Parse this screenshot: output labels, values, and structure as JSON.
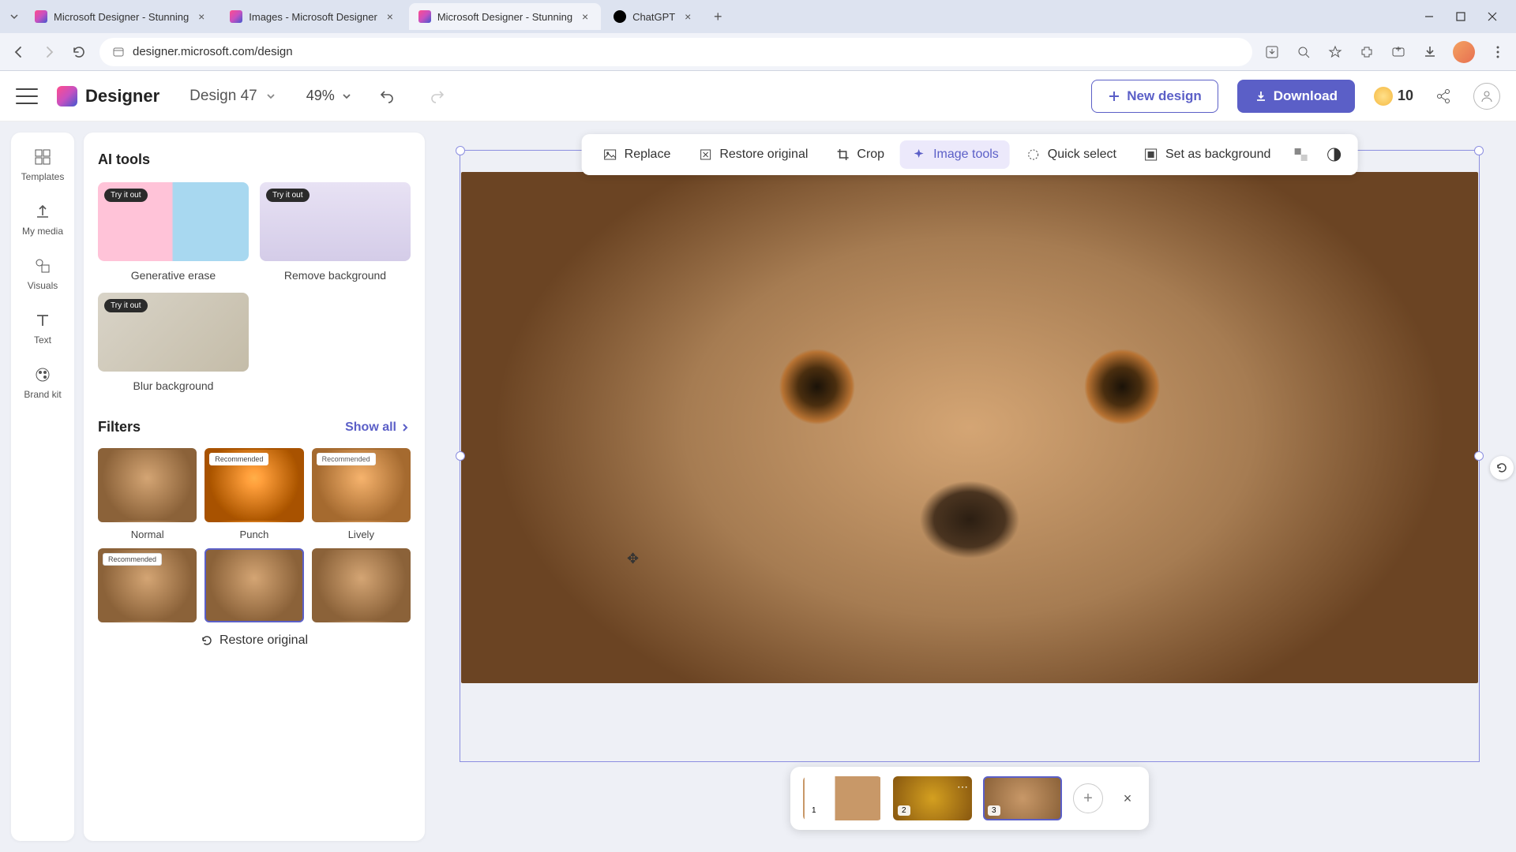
{
  "browser": {
    "tabs": [
      {
        "title": "Microsoft Designer - Stunning",
        "favicon": "designer"
      },
      {
        "title": "Images - Microsoft Designer",
        "favicon": "designer"
      },
      {
        "title": "Microsoft Designer - Stunning",
        "favicon": "designer",
        "active": true
      },
      {
        "title": "ChatGPT",
        "favicon": "chatgpt"
      }
    ],
    "url": "designer.microsoft.com/design"
  },
  "header": {
    "brand": "Designer",
    "design_name": "Design 47",
    "zoom": "49%",
    "new_design": "New design",
    "download": "Download",
    "credits": "10"
  },
  "rail": {
    "items": [
      {
        "label": "Templates",
        "icon": "templates"
      },
      {
        "label": "My media",
        "icon": "upload"
      },
      {
        "label": "Visuals",
        "icon": "visuals"
      },
      {
        "label": "Text",
        "icon": "text"
      },
      {
        "label": "Brand kit",
        "icon": "brandkit"
      }
    ]
  },
  "panel": {
    "ai_tools_title": "AI tools",
    "try_badge": "Try it out",
    "tools": [
      {
        "label": "Generative erase",
        "thumb": "te"
      },
      {
        "label": "Remove background",
        "thumb": "rb"
      },
      {
        "label": "Blur background",
        "thumb": "bb"
      }
    ],
    "filters_title": "Filters",
    "show_all": "Show all",
    "recommended_badge": "Recommended",
    "filters": [
      {
        "label": "Normal",
        "rec": false,
        "cls": ""
      },
      {
        "label": "Punch",
        "rec": true,
        "cls": "punch"
      },
      {
        "label": "Lively",
        "rec": true,
        "cls": "lively"
      }
    ],
    "filters_row2": [
      {
        "rec": true,
        "cls": ""
      },
      {
        "rec": false,
        "cls": "",
        "selected": true
      },
      {
        "rec": false,
        "cls": ""
      }
    ],
    "restore": "Restore original"
  },
  "context_toolbar": [
    {
      "label": "Replace",
      "icon": "image"
    },
    {
      "label": "Restore original",
      "icon": "restore"
    },
    {
      "label": "Crop",
      "icon": "crop"
    },
    {
      "label": "Image tools",
      "icon": "sparkle",
      "active": true
    },
    {
      "label": "Quick select",
      "icon": "quickselect"
    },
    {
      "label": "Set as background",
      "icon": "setbg"
    }
  ],
  "pages": [
    {
      "num": "1",
      "cls": "t1"
    },
    {
      "num": "2",
      "cls": "t2",
      "more": true
    },
    {
      "num": "3",
      "cls": "",
      "selected": true
    }
  ]
}
